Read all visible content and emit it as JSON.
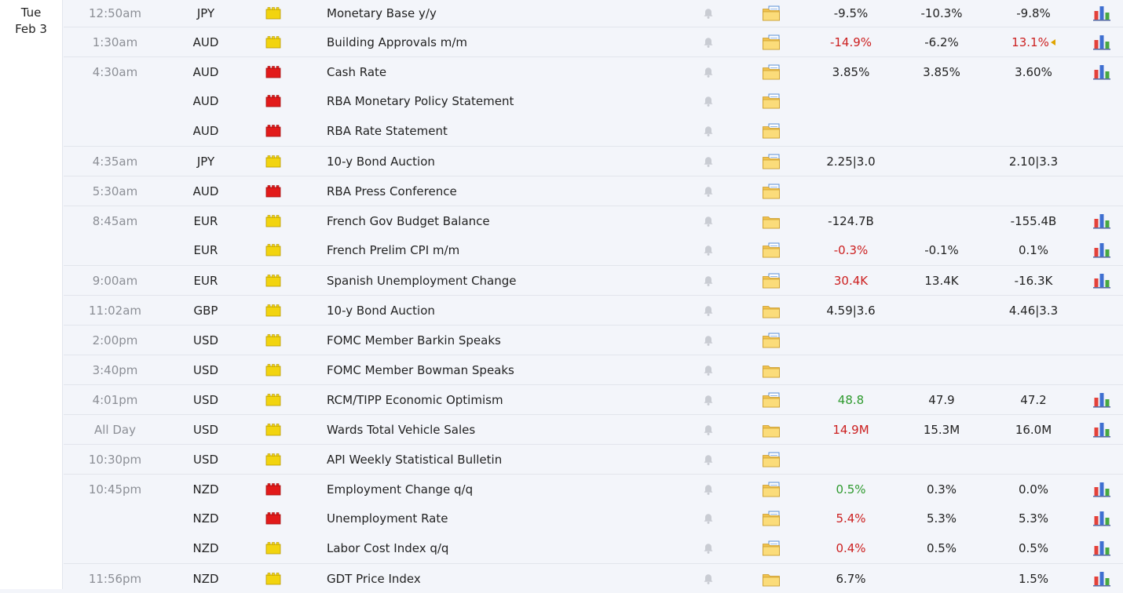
{
  "date": {
    "weekday": "Tue",
    "day": "Feb 3"
  },
  "colors": {
    "high_impact": "#e21a1a",
    "medium_impact": "#f2d40f",
    "negative": "#cc1f1f",
    "positive": "#2e9a2e"
  },
  "icons": {
    "bell": "bell-icon",
    "folder": "folder-icon",
    "chart": "bar-chart-icon"
  },
  "rows": [
    {
      "time": "12:50am",
      "currency": "JPY",
      "impact": "medium",
      "event": "Monetary Base y/y",
      "actual": "-9.5%",
      "actual_color": "",
      "forecast": "-10.3%",
      "previous": "-9.8%",
      "previous_color": "",
      "revised": false,
      "chart": true,
      "folder_detail": true,
      "sep": false
    },
    {
      "time": "1:30am",
      "currency": "AUD",
      "impact": "medium",
      "event": "Building Approvals m/m",
      "actual": "-14.9%",
      "actual_color": "red",
      "forecast": "-6.2%",
      "previous": "13.1%",
      "previous_color": "red",
      "revised": true,
      "chart": true,
      "folder_detail": true,
      "sep": true
    },
    {
      "time": "4:30am",
      "currency": "AUD",
      "impact": "high",
      "event": "Cash Rate",
      "actual": "3.85%",
      "actual_color": "",
      "forecast": "3.85%",
      "previous": "3.60%",
      "previous_color": "",
      "revised": false,
      "chart": true,
      "folder_detail": true,
      "sep": true
    },
    {
      "time": "",
      "currency": "AUD",
      "impact": "high",
      "event": "RBA Monetary Policy Statement",
      "actual": "",
      "actual_color": "",
      "forecast": "",
      "previous": "",
      "previous_color": "",
      "revised": false,
      "chart": false,
      "folder_detail": true,
      "sep": false
    },
    {
      "time": "",
      "currency": "AUD",
      "impact": "high",
      "event": "RBA Rate Statement",
      "actual": "",
      "actual_color": "",
      "forecast": "",
      "previous": "",
      "previous_color": "",
      "revised": false,
      "chart": false,
      "folder_detail": true,
      "sep": false
    },
    {
      "time": "4:35am",
      "currency": "JPY",
      "impact": "medium",
      "event": "10-y Bond Auction",
      "actual": "2.25|3.0",
      "actual_color": "",
      "forecast": "",
      "previous": "2.10|3.3",
      "previous_color": "",
      "revised": false,
      "chart": false,
      "folder_detail": true,
      "sep": true
    },
    {
      "time": "5:30am",
      "currency": "AUD",
      "impact": "high",
      "event": "RBA Press Conference",
      "actual": "",
      "actual_color": "",
      "forecast": "",
      "previous": "",
      "previous_color": "",
      "revised": false,
      "chart": false,
      "folder_detail": true,
      "sep": true
    },
    {
      "time": "8:45am",
      "currency": "EUR",
      "impact": "medium",
      "event": "French Gov Budget Balance",
      "actual": "-124.7B",
      "actual_color": "",
      "forecast": "",
      "previous": "-155.4B",
      "previous_color": "",
      "revised": false,
      "chart": true,
      "folder_detail": false,
      "sep": true
    },
    {
      "time": "",
      "currency": "EUR",
      "impact": "medium",
      "event": "French Prelim CPI m/m",
      "actual": "-0.3%",
      "actual_color": "red",
      "forecast": "-0.1%",
      "previous": "0.1%",
      "previous_color": "",
      "revised": false,
      "chart": true,
      "folder_detail": true,
      "sep": false
    },
    {
      "time": "9:00am",
      "currency": "EUR",
      "impact": "medium",
      "event": "Spanish Unemployment Change",
      "actual": "30.4K",
      "actual_color": "red",
      "forecast": "13.4K",
      "previous": "-16.3K",
      "previous_color": "",
      "revised": false,
      "chart": true,
      "folder_detail": true,
      "sep": true
    },
    {
      "time": "11:02am",
      "currency": "GBP",
      "impact": "medium",
      "event": "10-y Bond Auction",
      "actual": "4.59|3.6",
      "actual_color": "",
      "forecast": "",
      "previous": "4.46|3.3",
      "previous_color": "",
      "revised": false,
      "chart": false,
      "folder_detail": false,
      "sep": true
    },
    {
      "time": "2:00pm",
      "currency": "USD",
      "impact": "medium",
      "event": "FOMC Member Barkin Speaks",
      "actual": "",
      "actual_color": "",
      "forecast": "",
      "previous": "",
      "previous_color": "",
      "revised": false,
      "chart": false,
      "folder_detail": true,
      "sep": true
    },
    {
      "time": "3:40pm",
      "currency": "USD",
      "impact": "medium",
      "event": "FOMC Member Bowman Speaks",
      "actual": "",
      "actual_color": "",
      "forecast": "",
      "previous": "",
      "previous_color": "",
      "revised": false,
      "chart": false,
      "folder_detail": false,
      "sep": true
    },
    {
      "time": "4:01pm",
      "currency": "USD",
      "impact": "medium",
      "event": "RCM/TIPP Economic Optimism",
      "actual": "48.8",
      "actual_color": "green",
      "forecast": "47.9",
      "previous": "47.2",
      "previous_color": "",
      "revised": false,
      "chart": true,
      "folder_detail": true,
      "sep": true
    },
    {
      "time": "All Day",
      "currency": "USD",
      "impact": "medium",
      "event": "Wards Total Vehicle Sales",
      "actual": "14.9M",
      "actual_color": "red",
      "forecast": "15.3M",
      "previous": "16.0M",
      "previous_color": "",
      "revised": false,
      "chart": true,
      "folder_detail": false,
      "sep": true
    },
    {
      "time": "10:30pm",
      "currency": "USD",
      "impact": "medium",
      "event": "API Weekly Statistical Bulletin",
      "actual": "",
      "actual_color": "",
      "forecast": "",
      "previous": "",
      "previous_color": "",
      "revised": false,
      "chart": false,
      "folder_detail": true,
      "sep": true
    },
    {
      "time": "10:45pm",
      "currency": "NZD",
      "impact": "high",
      "event": "Employment Change q/q",
      "actual": "0.5%",
      "actual_color": "green",
      "forecast": "0.3%",
      "previous": "0.0%",
      "previous_color": "",
      "revised": false,
      "chart": true,
      "folder_detail": true,
      "sep": true
    },
    {
      "time": "",
      "currency": "NZD",
      "impact": "high",
      "event": "Unemployment Rate",
      "actual": "5.4%",
      "actual_color": "red",
      "forecast": "5.3%",
      "previous": "5.3%",
      "previous_color": "",
      "revised": false,
      "chart": true,
      "folder_detail": true,
      "sep": false
    },
    {
      "time": "",
      "currency": "NZD",
      "impact": "medium",
      "event": "Labor Cost Index q/q",
      "actual": "0.4%",
      "actual_color": "red",
      "forecast": "0.5%",
      "previous": "0.5%",
      "previous_color": "",
      "revised": false,
      "chart": true,
      "folder_detail": true,
      "sep": false
    },
    {
      "time": "11:56pm",
      "currency": "NZD",
      "impact": "medium",
      "event": "GDT Price Index",
      "actual": "6.7%",
      "actual_color": "",
      "forecast": "",
      "previous": "1.5%",
      "previous_color": "",
      "revised": false,
      "chart": true,
      "folder_detail": false,
      "sep": true
    }
  ]
}
